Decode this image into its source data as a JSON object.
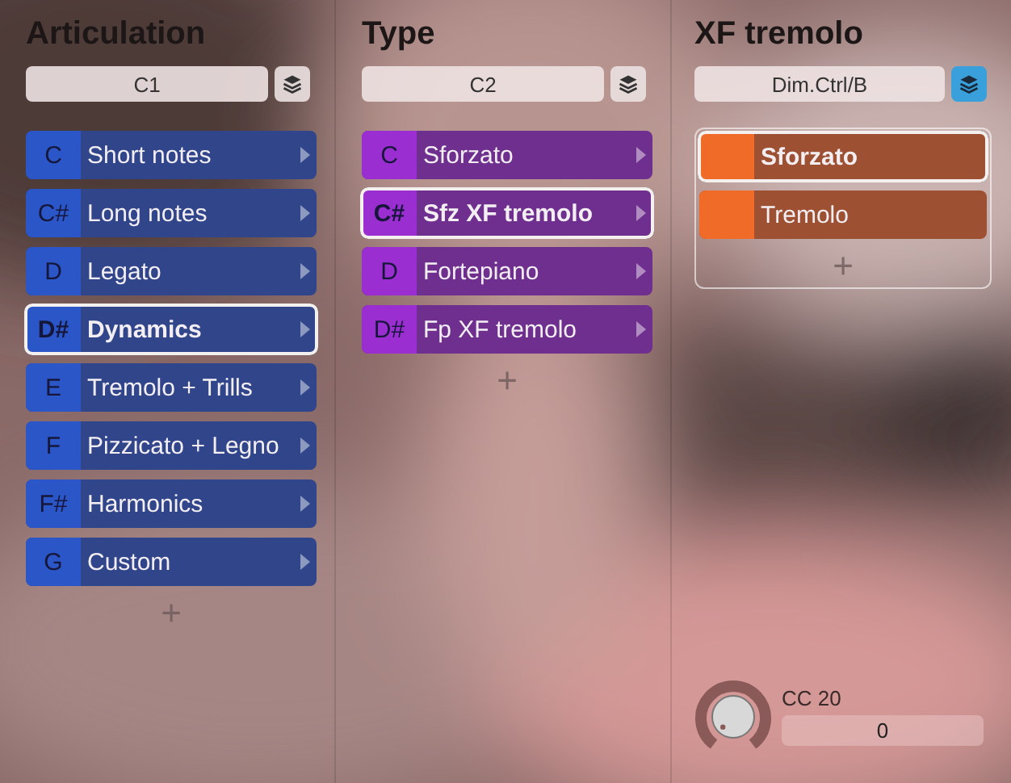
{
  "columns": [
    {
      "title": "Articulation",
      "selector": "C1",
      "layers_on": false,
      "color": "#2a56c8",
      "boxed": false,
      "submenu": true,
      "items": [
        {
          "key": "C",
          "label": "Short notes",
          "selected": false
        },
        {
          "key": "C#",
          "label": "Long notes",
          "selected": false
        },
        {
          "key": "D",
          "label": "Legato",
          "selected": false
        },
        {
          "key": "D#",
          "label": "Dynamics",
          "selected": true
        },
        {
          "key": "E",
          "label": "Tremolo + Trills",
          "selected": false
        },
        {
          "key": "F",
          "label": "Pizzicato + Legno",
          "selected": false
        },
        {
          "key": "F#",
          "label": "Harmonics",
          "selected": false
        },
        {
          "key": "G",
          "label": "Custom",
          "selected": false
        }
      ],
      "add": "+"
    },
    {
      "title": "Type",
      "selector": "C2",
      "layers_on": false,
      "color": "#9a2ed0",
      "boxed": false,
      "submenu": true,
      "items": [
        {
          "key": "C",
          "label": "Sforzato",
          "selected": false
        },
        {
          "key": "C#",
          "label": "Sfz XF tremolo",
          "selected": true
        },
        {
          "key": "D",
          "label": "Fortepiano",
          "selected": false
        },
        {
          "key": "D#",
          "label": "Fp XF tremolo",
          "selected": false
        }
      ],
      "add": "+"
    },
    {
      "title": "XF tremolo",
      "selector": "Dim.Ctrl/B",
      "layers_on": true,
      "color": "#f06a28",
      "boxed": true,
      "submenu": false,
      "items": [
        {
          "label": "Sforzato",
          "selected": true
        },
        {
          "label": "Tremolo",
          "selected": false
        }
      ],
      "add": "+"
    }
  ],
  "controller": {
    "label": "CC 20",
    "value": "0"
  }
}
